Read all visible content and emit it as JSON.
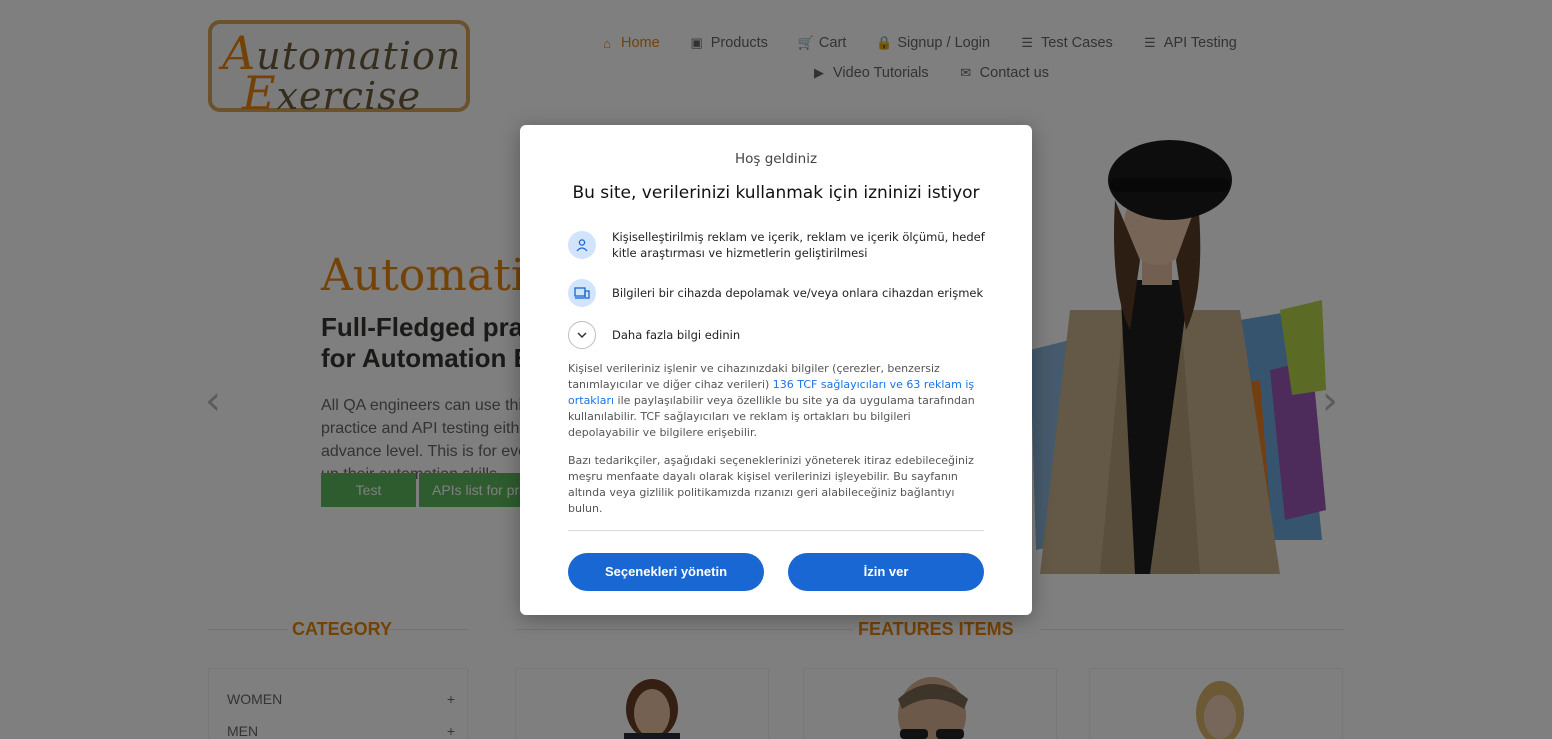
{
  "header": {
    "logo": {
      "line1_cap": "A",
      "line1_rest": "utomation",
      "line2_cap": "E",
      "line2_rest": "xercise"
    },
    "nav": [
      {
        "label": "Home",
        "icon": "home-icon",
        "glyph": "⌂",
        "active": true
      },
      {
        "label": "Products",
        "icon": "briefcase-icon",
        "glyph": "▣"
      },
      {
        "label": "Cart",
        "icon": "cart-icon",
        "glyph": "🛒"
      },
      {
        "label": "Signup / Login",
        "icon": "lock-icon",
        "glyph": "🔒"
      },
      {
        "label": "Test Cases",
        "icon": "list-icon",
        "glyph": "☰"
      },
      {
        "label": "API Testing",
        "icon": "list-icon",
        "glyph": "☰"
      },
      {
        "label": "Video Tutorials",
        "icon": "youtube-icon",
        "glyph": "▶"
      },
      {
        "label": "Contact us",
        "icon": "envelope-icon",
        "glyph": "✉"
      }
    ]
  },
  "hero": {
    "title": "AutomationExercise",
    "subtitle": "Full-Fledged practice website for Automation Engineers",
    "text": "All QA engineers can use this website for automation practice and API testing either they are at beginner or advance level. This is for everybody to help them brush up their automation skills.",
    "btn_test_cases": "Test Cases",
    "btn_apis": "APIs list for practice",
    "prev_arrow": "‹",
    "next_arrow": "›"
  },
  "sections": {
    "category_title": "CATEGORY",
    "features_title": "FEATURES ITEMS",
    "categories": [
      {
        "label": "WOMEN",
        "toggle": "+"
      },
      {
        "label": "MEN",
        "toggle": "+"
      }
    ]
  },
  "consent": {
    "welcome": "Hoş geldiniz",
    "title": "Bu site, verilerinizi kullanmak için izninizi istiyor",
    "purposes": [
      {
        "text": "Kişiselleştirilmiş reklam ve içerik, reklam ve içerik ölçümü, hedef kitle araştırması ve hizmetlerin geliştirilmesi",
        "icon": "person-icon"
      },
      {
        "text": "Bilgileri bir cihazda depolamak ve/veya onlara cihazdan erişmek",
        "icon": "devices-icon"
      },
      {
        "text": "Daha fazla bilgi edinin",
        "icon": "chevron-down-icon"
      }
    ],
    "para1_before": "Kişisel verileriniz işlenir ve cihazınızdaki bilgiler (çerezler, benzersiz tanımlayıcılar ve diğer cihaz verileri) ",
    "para1_link": "136 TCF sağlayıcıları ve 63 reklam iş ortakları",
    "para1_after": " ile paylaşılabilir veya özellikle bu site ya da uygulama tarafından kullanılabilir. TCF sağlayıcıları ve reklam iş ortakları bu bilgileri depolayabilir ve bilgilere erişebilir.",
    "para2": "Bazı tedarikçiler, aşağıdaki seçeneklerinizi yöneterek itiraz edebileceğiniz meşru menfaate dayalı olarak kişisel verilerinizi işleyebilir. Bu sayfanın altında veya gizlilik politikamızda rızanızı geri alabileceğiniz bağlantıyı bulun.",
    "btn_manage": "Seçenekleri yönetin",
    "btn_consent": "İzin ver"
  },
  "colors": {
    "accent": "#e8850c",
    "consent_blue": "#1967d2",
    "green": "#5cb85c"
  }
}
